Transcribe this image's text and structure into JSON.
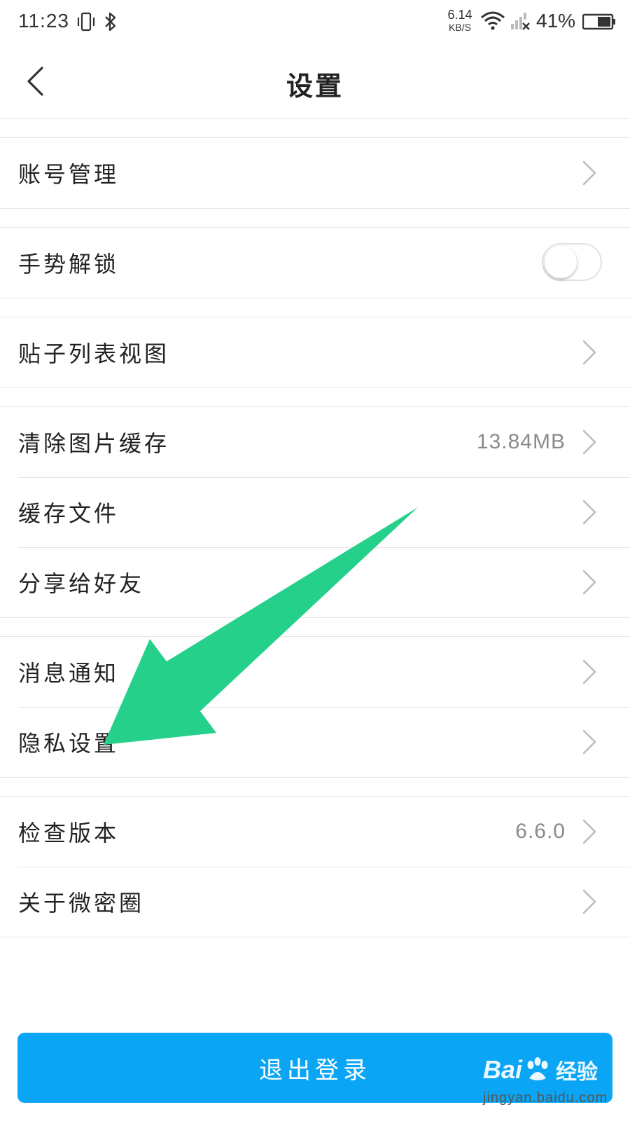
{
  "status_bar": {
    "time": "11:23",
    "net_speed": "6.14",
    "net_speed_unit": "KB/S",
    "battery": "41%"
  },
  "nav": {
    "title": "设置"
  },
  "groups": [
    {
      "items": [
        {
          "label": "账号管理"
        }
      ]
    },
    {
      "items": [
        {
          "label": "手势解锁",
          "toggle": false
        }
      ]
    },
    {
      "items": [
        {
          "label": "贴子列表视图"
        }
      ]
    },
    {
      "items": [
        {
          "label": "清除图片缓存",
          "value": "13.84MB"
        },
        {
          "label": "缓存文件"
        },
        {
          "label": "分享给好友"
        }
      ]
    },
    {
      "items": [
        {
          "label": "消息通知"
        },
        {
          "label": "隐私设置"
        }
      ]
    },
    {
      "items": [
        {
          "label": "检查版本",
          "value": "6.6.0"
        },
        {
          "label": "关于微密圈"
        }
      ]
    }
  ],
  "logout": {
    "label": "退出登录"
  },
  "annotation": {
    "color": "#24d08a",
    "target": "隐私设置"
  },
  "accent_color": "#0aa6f5",
  "watermark": {
    "brand_left": "Bai",
    "brand_right": "经验",
    "url": "jingyan.baidu.com"
  },
  "icons": {
    "back": "chevron-left-icon",
    "row_arrow": "chevron-right-icon",
    "status": [
      "vibrate-icon",
      "bluetooth-icon",
      "wifi-icon",
      "signal-icon",
      "battery-icon"
    ]
  }
}
